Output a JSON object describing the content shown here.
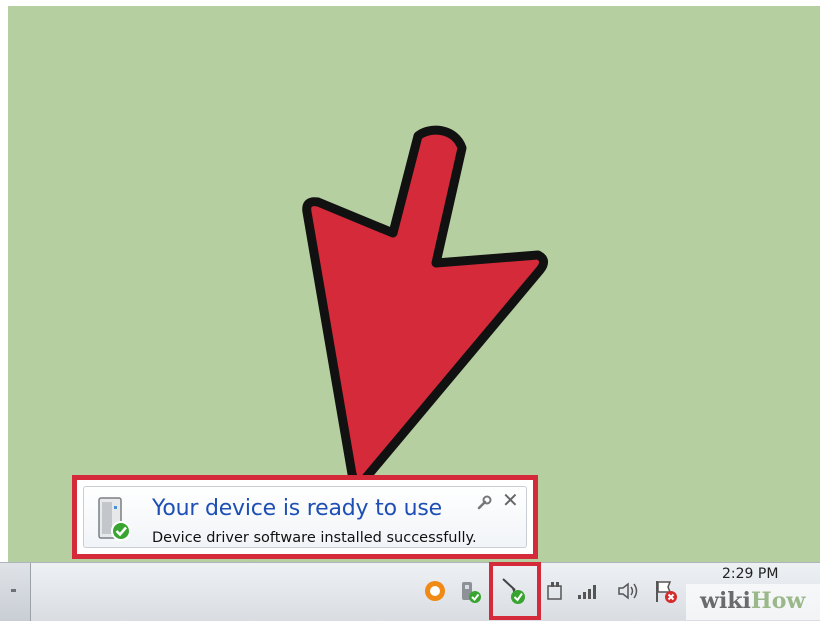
{
  "notification": {
    "title": "Your device is ready to use",
    "message": "Device driver software installed successfully."
  },
  "taskbar": {
    "clock_time": "2:29 PM",
    "tray_icons": [
      "avast-icon",
      "power-device-icon",
      "device-driver-icon",
      "safely-remove-hardware-icon",
      "network-signal-icon",
      "volume-icon",
      "action-center-flag-icon"
    ]
  },
  "watermark": {
    "part1": "wiki",
    "part2": "How"
  },
  "colors": {
    "highlight": "#d52a3a",
    "desktop": "#b5cfa0",
    "title_blue": "#1e4fb5"
  }
}
